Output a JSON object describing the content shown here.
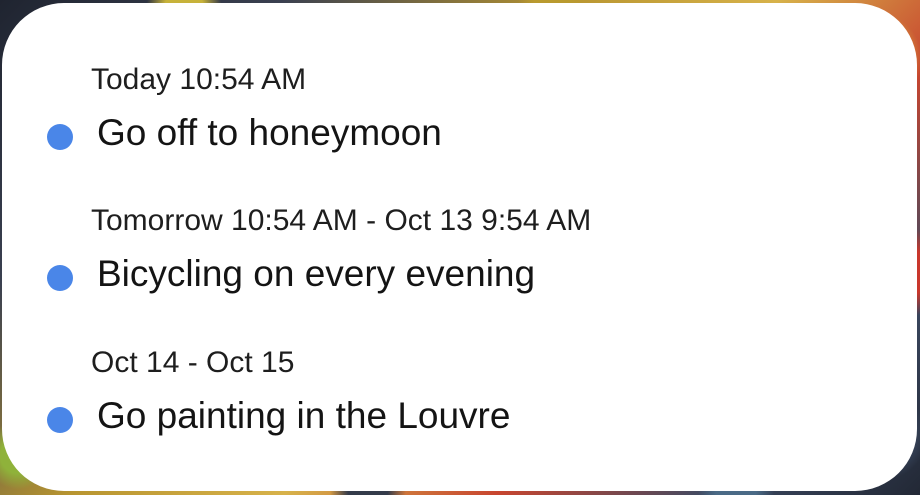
{
  "events": [
    {
      "time": "Today 10:54 AM",
      "title": "Go off to honeymoon",
      "dot_color": "#4a86e8"
    },
    {
      "time": "Tomorrow 10:54 AM - Oct 13 9:54 AM",
      "title": "Bicycling on every evening",
      "dot_color": "#4a86e8"
    },
    {
      "time": "Oct 14 - Oct 15",
      "title": "Go painting in the Louvre",
      "dot_color": "#4a86e8"
    }
  ]
}
